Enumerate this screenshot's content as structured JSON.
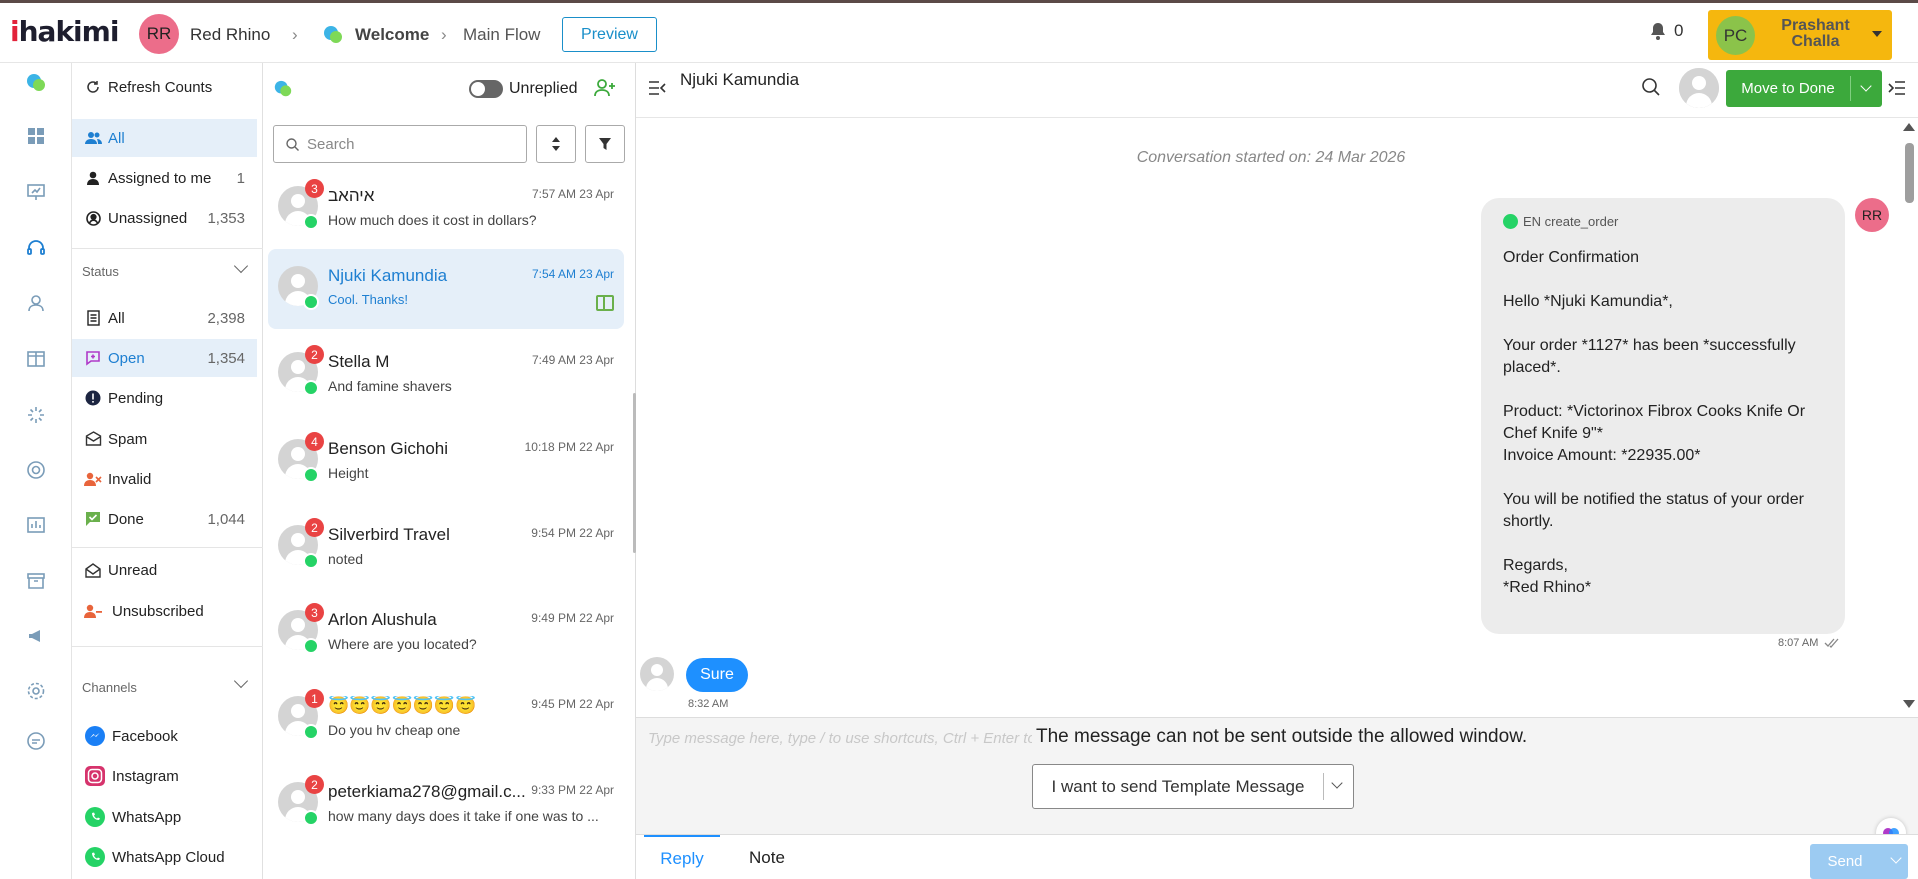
{
  "brand": {
    "logo": "ihakimi"
  },
  "topbar": {
    "org_initials": "RR",
    "org_name": "Red Rhino",
    "crumb_welcome": "Welcome",
    "crumb_flow": "Main Flow",
    "preview_label": "Preview",
    "notification_count": "0",
    "user_initials": "PC",
    "user_name": "Prashant Challa"
  },
  "folders": {
    "refresh_label": "Refresh Counts",
    "inbox": [
      {
        "label": "All",
        "count": "",
        "icon": "users-icon"
      },
      {
        "label": "Assigned to me",
        "count": "1",
        "icon": "user-icon"
      },
      {
        "label": "Unassigned",
        "count": "1,353",
        "icon": "user-circle-icon"
      }
    ],
    "status_title": "Status",
    "status": [
      {
        "label": "All",
        "count": "2,398",
        "icon": "document-icon"
      },
      {
        "label": "Open",
        "count": "1,354",
        "icon": "open-chat-icon"
      },
      {
        "label": "Pending",
        "count": "",
        "icon": "pending-icon"
      },
      {
        "label": "Spam",
        "count": "",
        "icon": "spam-icon"
      },
      {
        "label": "Invalid",
        "count": "",
        "icon": "invalid-icon"
      },
      {
        "label": "Done",
        "count": "1,044",
        "icon": "done-icon"
      }
    ],
    "extra": [
      {
        "label": "Unread",
        "icon": "envelope-open-icon"
      },
      {
        "label": "Unsubscribed",
        "icon": "user-minus-icon"
      }
    ],
    "channels_title": "Channels",
    "channels": [
      {
        "label": "Facebook",
        "icon": "messenger-icon"
      },
      {
        "label": "Instagram",
        "icon": "instagram-icon"
      },
      {
        "label": "WhatsApp",
        "icon": "whatsapp-icon"
      },
      {
        "label": "WhatsApp Cloud",
        "icon": "whatsapp-icon"
      }
    ]
  },
  "convlist": {
    "unreplied_label": "Unreplied",
    "search_placeholder": "Search",
    "items": [
      {
        "name": "איהאב",
        "time": "7:57 AM 23 Apr",
        "message": "How much does it cost in dollars?",
        "badge": "3"
      },
      {
        "name": "Njuki Kamundia",
        "time": "7:54 AM 23 Apr",
        "message": "Cool. Thanks!",
        "badge": ""
      },
      {
        "name": "Stella M",
        "time": "7:49 AM 23 Apr",
        "message": "And famine shavers",
        "badge": "2"
      },
      {
        "name": "Benson Gichohi",
        "time": "10:18 PM 22 Apr",
        "message": "Height",
        "badge": "4"
      },
      {
        "name": "Silverbird Travel",
        "time": "9:54 PM 22 Apr",
        "message": "noted",
        "badge": "2"
      },
      {
        "name": "Arlon Alushula",
        "time": "9:49 PM 22 Apr",
        "message": "Where are you located?",
        "badge": "3"
      },
      {
        "name": "😇😇😇😇😇😇😇",
        "time": "9:45 PM 22 Apr",
        "message": "Do you hv cheap one",
        "badge": "1"
      },
      {
        "name": "peterkiama278@gmail.c...",
        "time": "9:33 PM 22 Apr",
        "message": "how many days does it take if one was to ...",
        "badge": "2"
      }
    ]
  },
  "chat": {
    "contact_name": "Njuki Kamundia",
    "move_to_done": "Move to Done",
    "started_text": "Conversation started on: 24 Mar 2026",
    "template_tag": "EN create_order",
    "outgoing_lines": [
      "Order Confirmation",
      "",
      "Hello *Njuki Kamundia*,",
      "",
      "Your order *1127* has been *successfully placed*.",
      "",
      "Product: *Victorinox Fibrox Cooks Knife Or Chef Knife 9\"*",
      "Invoice Amount: *22935.00*",
      "",
      "You will be notified the status of your order shortly.",
      "",
      "Regards,",
      "*Red Rhino*"
    ],
    "sender_initials": "RR",
    "outgoing_time": "8:07 AM",
    "incoming_text": "Sure",
    "incoming_time": "8:32 AM",
    "composer_placeholder": "Type message here, type / to use shortcuts, Ctrl + Enter to send",
    "window_notice": "The message can not be sent outside the allowed window.",
    "template_button": "I want to send Template Message",
    "tab_reply": "Reply",
    "tab_note": "Note",
    "send_label": "Send"
  },
  "colors": {
    "accent_blue": "#1e90ff",
    "done_green": "#3ca93c",
    "user_yellow": "#f5b70e",
    "badge_red": "#e94343",
    "whatsapp_green": "#25d366"
  }
}
